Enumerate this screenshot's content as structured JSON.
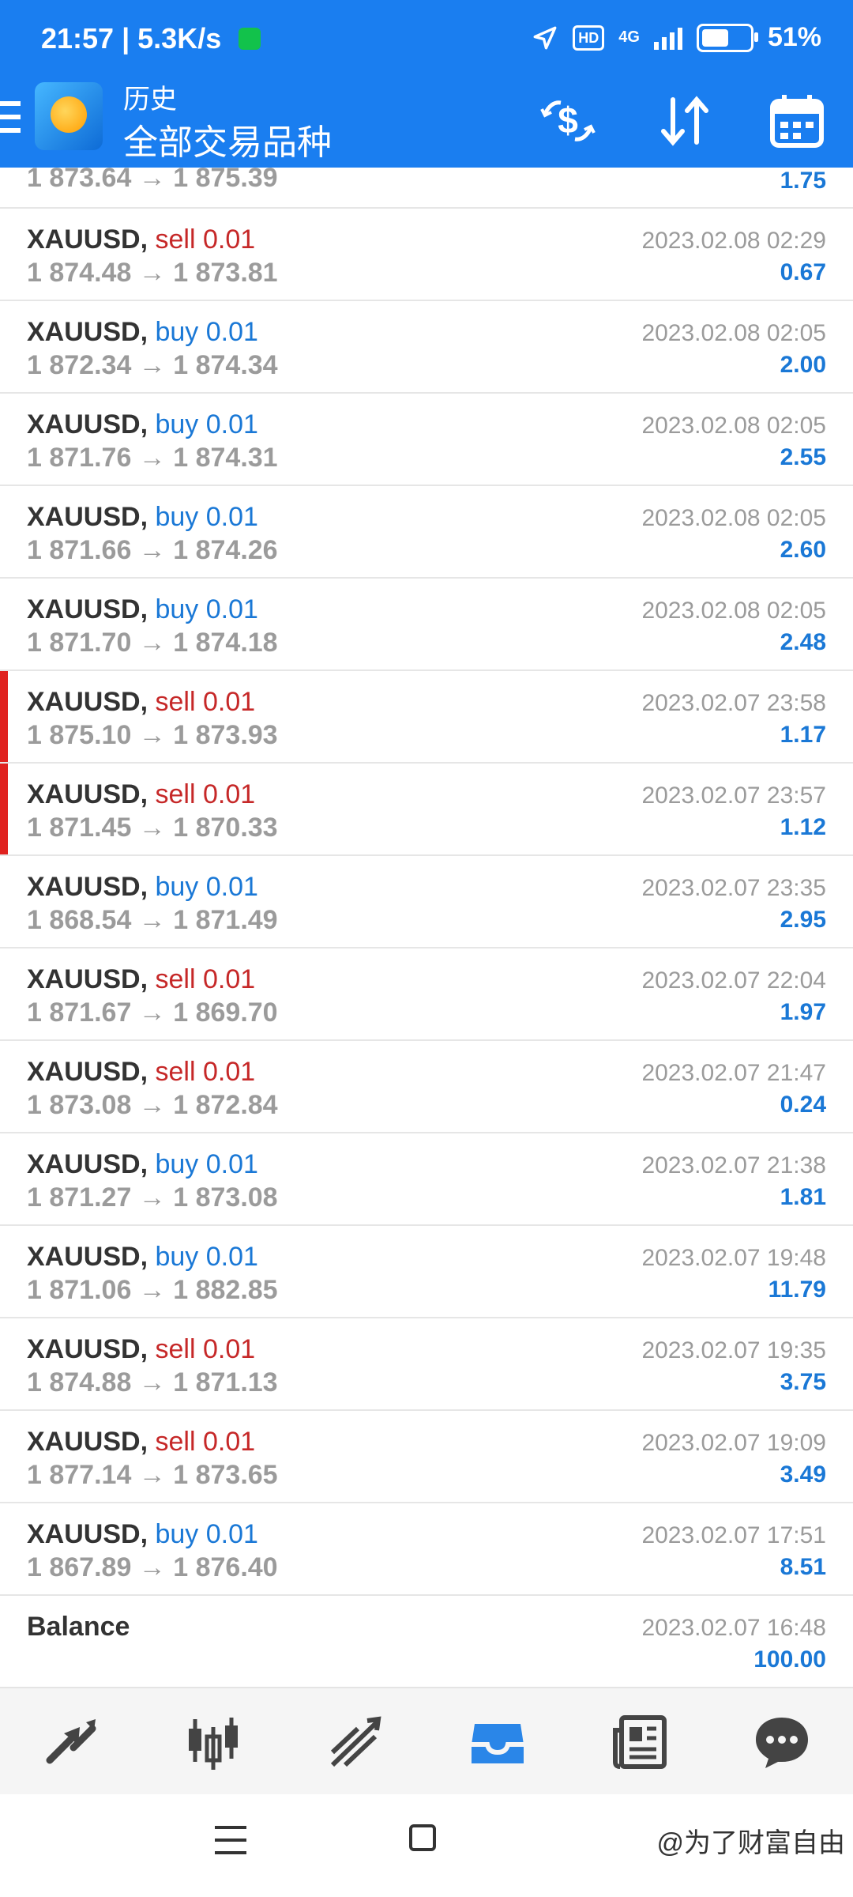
{
  "status": {
    "time": "21:57",
    "net_speed": "5.3K/s",
    "hd": "HD",
    "network": "4G",
    "battery": "51%"
  },
  "header": {
    "title_small": "历史",
    "title_big": "全部交易品种",
    "icons": [
      "menu-icon",
      "currency-exchange-icon",
      "sort-icon",
      "calendar-icon"
    ]
  },
  "rows": [
    {
      "partial": true,
      "symbol": "",
      "type": "",
      "volume": "",
      "prices": "1 873.64 → 1 875.39",
      "date": "",
      "profit": "1.75",
      "accent": false
    },
    {
      "symbol": "XAUUSD,",
      "type": "sell",
      "volume": "0.01",
      "prices": "1 874.48 → 1 873.81",
      "date": "2023.02.08 02:29",
      "profit": "0.67",
      "accent": false
    },
    {
      "symbol": "XAUUSD,",
      "type": "buy",
      "volume": "0.01",
      "prices": "1 872.34 → 1 874.34",
      "date": "2023.02.08 02:05",
      "profit": "2.00",
      "accent": false
    },
    {
      "symbol": "XAUUSD,",
      "type": "buy",
      "volume": "0.01",
      "prices": "1 871.76 → 1 874.31",
      "date": "2023.02.08 02:05",
      "profit": "2.55",
      "accent": false
    },
    {
      "symbol": "XAUUSD,",
      "type": "buy",
      "volume": "0.01",
      "prices": "1 871.66 → 1 874.26",
      "date": "2023.02.08 02:05",
      "profit": "2.60",
      "accent": false
    },
    {
      "symbol": "XAUUSD,",
      "type": "buy",
      "volume": "0.01",
      "prices": "1 871.70 → 1 874.18",
      "date": "2023.02.08 02:05",
      "profit": "2.48",
      "accent": false
    },
    {
      "symbol": "XAUUSD,",
      "type": "sell",
      "volume": "0.01",
      "prices": "1 875.10 → 1 873.93",
      "date": "2023.02.07 23:58",
      "profit": "1.17",
      "accent": true
    },
    {
      "symbol": "XAUUSD,",
      "type": "sell",
      "volume": "0.01",
      "prices": "1 871.45 → 1 870.33",
      "date": "2023.02.07 23:57",
      "profit": "1.12",
      "accent": true
    },
    {
      "symbol": "XAUUSD,",
      "type": "buy",
      "volume": "0.01",
      "prices": "1 868.54 → 1 871.49",
      "date": "2023.02.07 23:35",
      "profit": "2.95",
      "accent": false
    },
    {
      "symbol": "XAUUSD,",
      "type": "sell",
      "volume": "0.01",
      "prices": "1 871.67 → 1 869.70",
      "date": "2023.02.07 22:04",
      "profit": "1.97",
      "accent": false
    },
    {
      "symbol": "XAUUSD,",
      "type": "sell",
      "volume": "0.01",
      "prices": "1 873.08 → 1 872.84",
      "date": "2023.02.07 21:47",
      "profit": "0.24",
      "accent": false
    },
    {
      "symbol": "XAUUSD,",
      "type": "buy",
      "volume": "0.01",
      "prices": "1 871.27 → 1 873.08",
      "date": "2023.02.07 21:38",
      "profit": "1.81",
      "accent": false
    },
    {
      "symbol": "XAUUSD,",
      "type": "buy",
      "volume": "0.01",
      "prices": "1 871.06 → 1 882.85",
      "date": "2023.02.07 19:48",
      "profit": "11.79",
      "accent": false
    },
    {
      "symbol": "XAUUSD,",
      "type": "sell",
      "volume": "0.01",
      "prices": "1 874.88 → 1 871.13",
      "date": "2023.02.07 19:35",
      "profit": "3.75",
      "accent": false
    },
    {
      "symbol": "XAUUSD,",
      "type": "sell",
      "volume": "0.01",
      "prices": "1 877.14 → 1 873.65",
      "date": "2023.02.07 19:09",
      "profit": "3.49",
      "accent": false
    },
    {
      "symbol": "XAUUSD,",
      "type": "buy",
      "volume": "0.01",
      "prices": "1 867.89 → 1 876.40",
      "date": "2023.02.07 17:51",
      "profit": "8.51",
      "accent": false
    },
    {
      "symbol": "Balance",
      "type": "",
      "volume": "",
      "prices": "",
      "date": "2023.02.07 16:48",
      "profit": "100.00",
      "accent": false
    }
  ],
  "tabs": [
    {
      "name": "quotes-tab",
      "icon": "quotes-arrows-icon"
    },
    {
      "name": "chart-tab",
      "icon": "candlestick-icon"
    },
    {
      "name": "trade-tab",
      "icon": "trend-icon"
    },
    {
      "name": "history-tab",
      "icon": "inbox-icon",
      "active": true
    },
    {
      "name": "news-tab",
      "icon": "newspaper-icon"
    },
    {
      "name": "chat-tab",
      "icon": "chat-icon"
    }
  ],
  "sysnav": {
    "watermark": "@为了财富自由"
  },
  "colors": {
    "primary": "#1a7ef0",
    "sell": "#c62828",
    "buy": "#1a78d6",
    "accent_red": "#e0221f"
  }
}
